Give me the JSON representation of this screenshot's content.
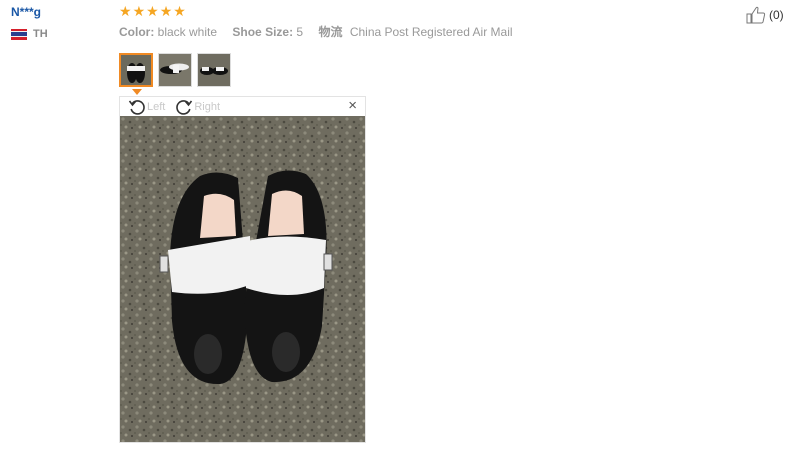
{
  "reviewer": {
    "name": "N***g",
    "country_code": "TH",
    "flag": "thailand-flag-icon"
  },
  "rating": {
    "stars": 5,
    "max": 5,
    "color": "#f5a623"
  },
  "attributes": {
    "color_key": "Color:",
    "color_value": "black white",
    "size_key": "Shoe Size:",
    "size_value": "5",
    "shipping_key": "物流",
    "shipping_value": "China Post Registered Air Mail"
  },
  "helpful": {
    "icon": "thumbs-up-icon",
    "count": "(0)"
  },
  "viewer": {
    "rotate_left": "Left",
    "rotate_right": "Right",
    "close": "×",
    "thumbnail_count": 3,
    "active_thumbnail": 1
  },
  "colors": {
    "accent": "#f08a24",
    "link": "#1a57a6",
    "muted": "#999999"
  }
}
